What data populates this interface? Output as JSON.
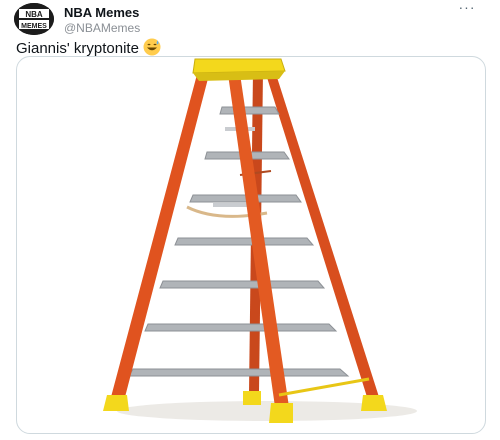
{
  "tweet": {
    "author_name": "NBA Memes",
    "author_handle": "@NBAMemes",
    "text": "Giannis' kryptonite",
    "emoji": "grinning-sweat-emoji",
    "more_icon": "more-horizontal-icon",
    "avatar_text": "NBA MEMES",
    "media": {
      "subject": "orange-fiberglass-step-ladder-icon"
    }
  },
  "colors": {
    "ladder_orange": "#e0531f",
    "ladder_yellow": "#f3d81c",
    "rung_silver": "#a8adb2",
    "border": "#cfd9de"
  }
}
